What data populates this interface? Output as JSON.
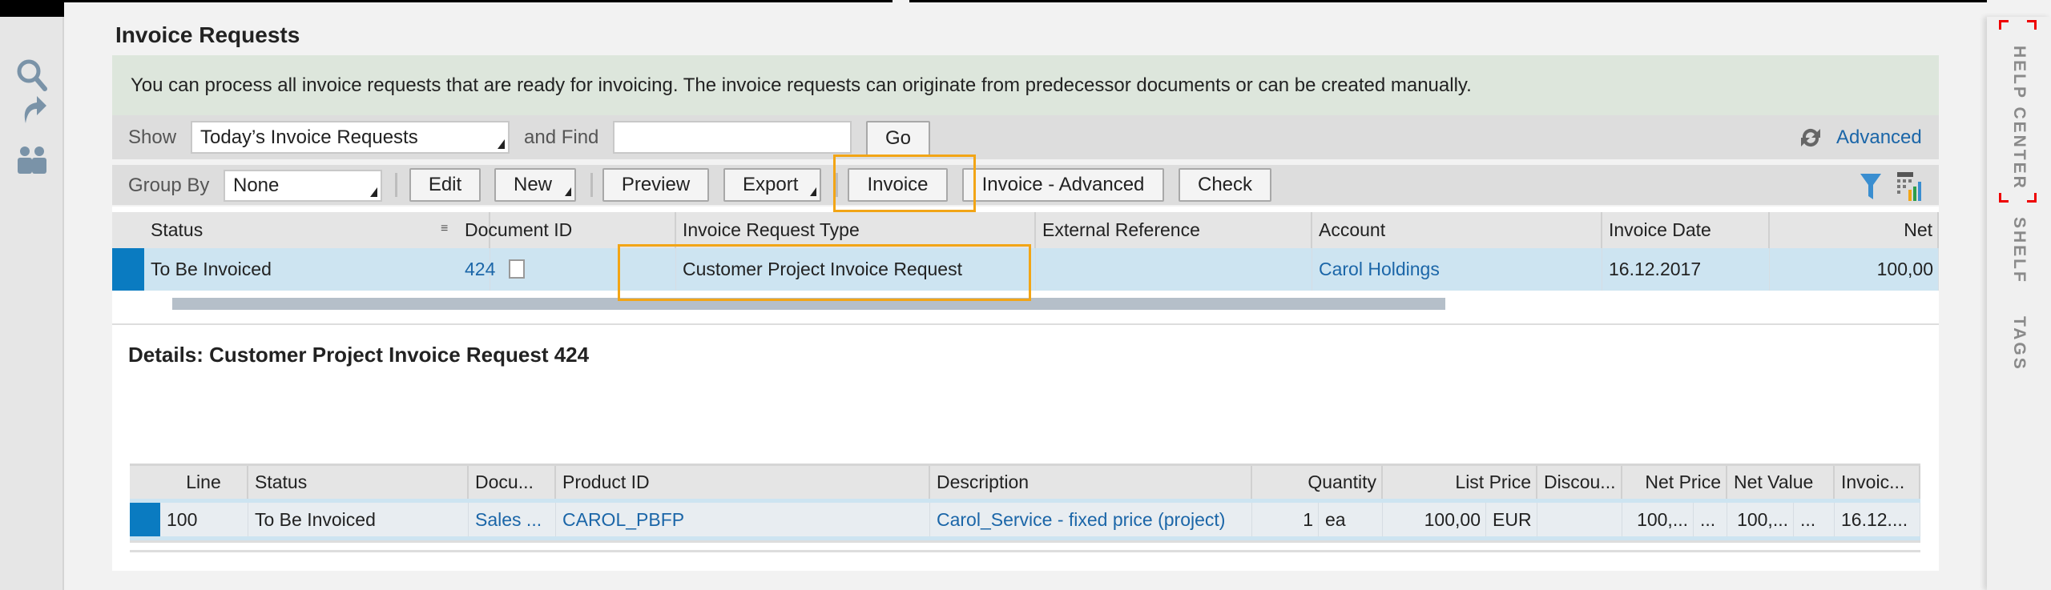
{
  "sidebar": {
    "icons": [
      "search-icon",
      "share-arrow-icon",
      "people-icon"
    ]
  },
  "right_panel": {
    "items": [
      "HELP CENTER",
      "SHELF",
      "TAGS"
    ]
  },
  "page": {
    "title": "Invoice Requests",
    "banner": "You can process all invoice requests that are ready for invoicing. The invoice requests can originate from predecessor documents or can be created manually."
  },
  "filter": {
    "show_label": "Show",
    "show_value": "Today’s Invoice Requests",
    "find_label": "and Find",
    "find_value": "",
    "go_label": "Go",
    "advanced_label": "Advanced"
  },
  "toolbar": {
    "group_by_label": "Group By",
    "group_by_value": "None",
    "edit": "Edit",
    "new": "New",
    "preview": "Preview",
    "export": "Export",
    "invoice": "Invoice",
    "invoice_advanced": "Invoice - Advanced",
    "check": "Check"
  },
  "main_table": {
    "columns": [
      "Status",
      "Document ID",
      "Invoice Request Type",
      "External Reference",
      "Account",
      "Invoice Date",
      "Net"
    ],
    "rows": [
      {
        "status": "To Be Invoiced",
        "document_id": "424",
        "type": "Customer Project Invoice Request",
        "external_reference": "",
        "account": "Carol Holdings",
        "invoice_date": "16.12.2017",
        "net": "100,00"
      }
    ]
  },
  "details": {
    "title": "Details: Customer Project Invoice Request 424",
    "columns": [
      "Line",
      "Status",
      "Docu...",
      "Product ID",
      "Description",
      "Quantity",
      "List Price",
      "Discou...",
      "Net Price",
      "Net Value",
      "Invoic..."
    ],
    "rows": [
      {
        "line": "100",
        "status": "To Be Invoiced",
        "document": "Sales ...",
        "product_id": "CAROL_PBFP",
        "description": "Carol_Service - fixed price (project)",
        "quantity": "1",
        "unit": "ea",
        "list_price": "100,00",
        "currency": "EUR",
        "discount": "",
        "net_price": "100,...",
        "net_price_unit": "...",
        "net_value": "100,...",
        "net_value_unit": "...",
        "invoice_date": "16.12...."
      }
    ]
  },
  "colors": {
    "accent": "#1b66a8",
    "highlight": "#f2a516",
    "selected_row": "#cde4f1",
    "indicator": "#0a7bc1",
    "banner": "#dde6dc"
  }
}
